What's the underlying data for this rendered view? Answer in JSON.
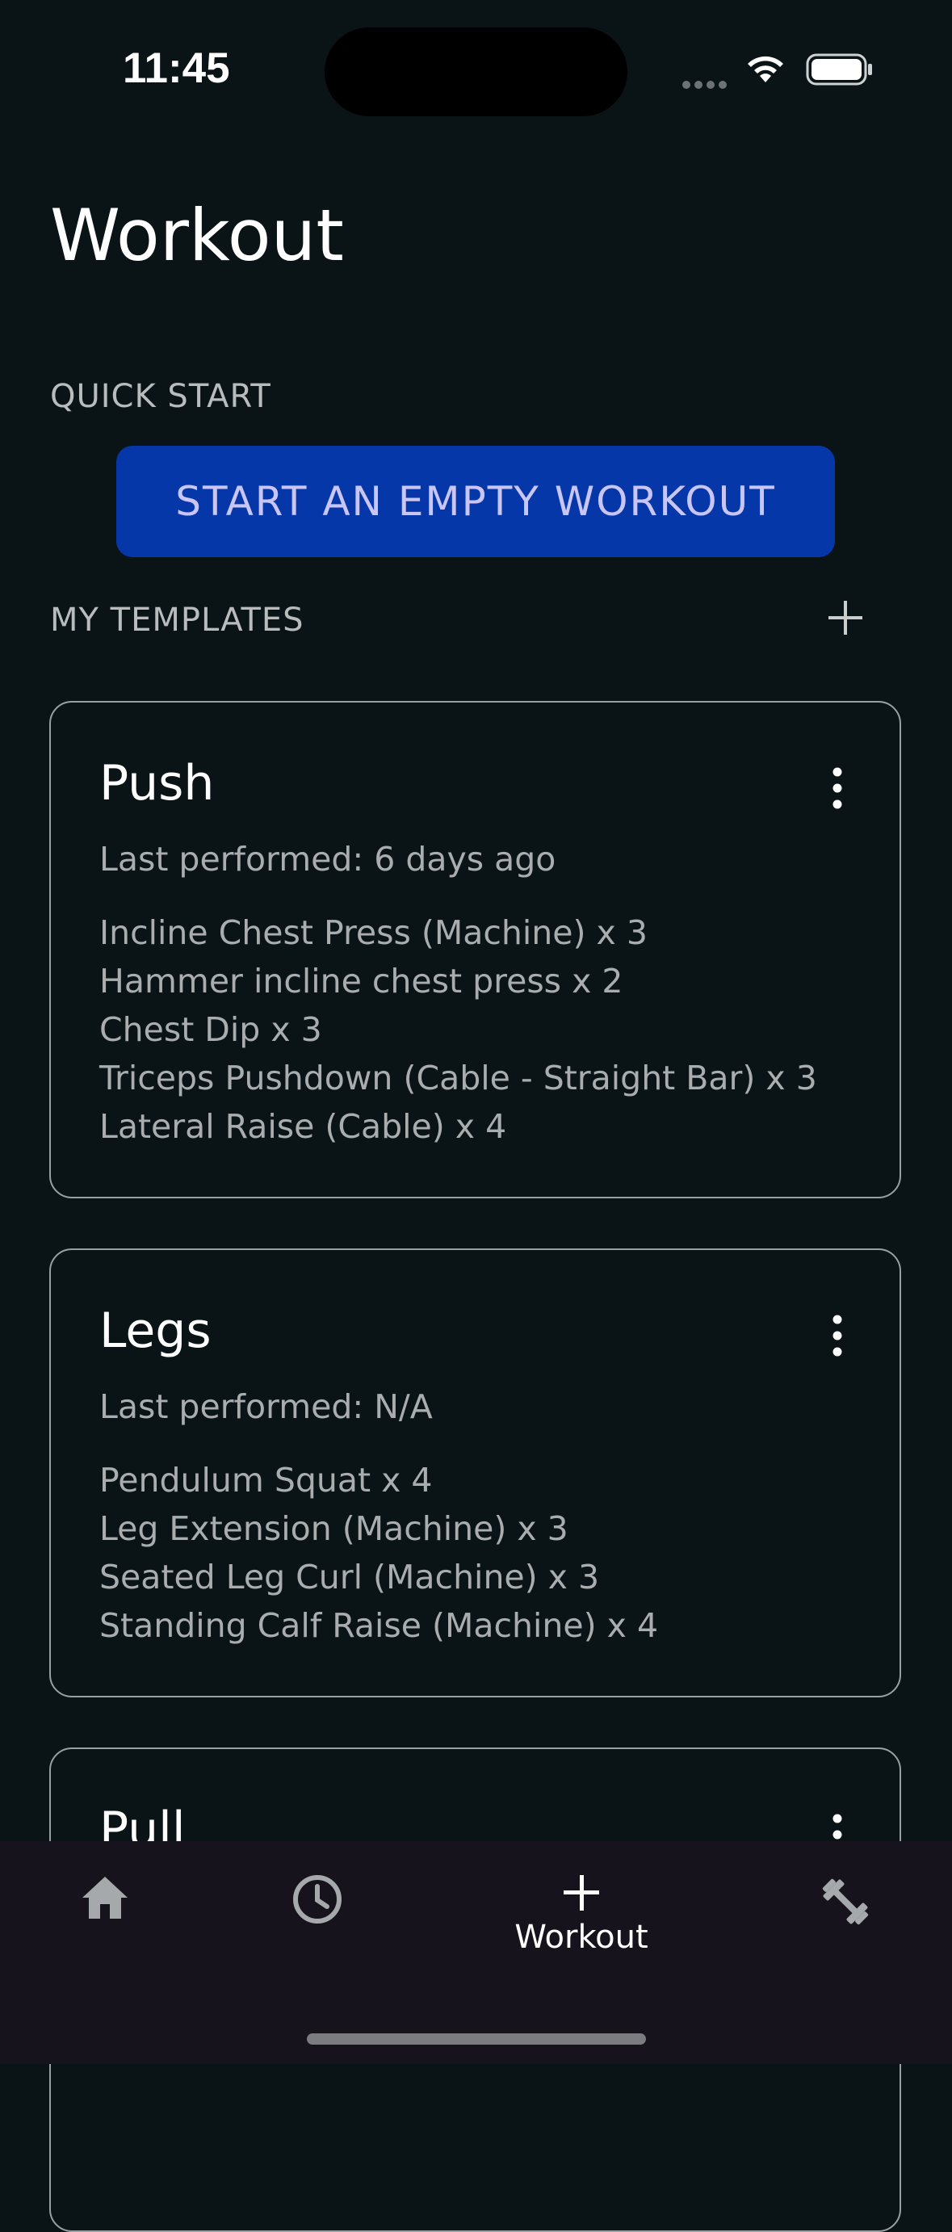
{
  "status_bar": {
    "time": "11:45"
  },
  "header": {
    "title": "Workout"
  },
  "quick_start": {
    "label": "QUICK START",
    "button_label": "START AN EMPTY WORKOUT"
  },
  "templates": {
    "label": "MY TEMPLATES",
    "items": [
      {
        "name": "Push",
        "last_performed": "Last performed: 6 days ago",
        "exercises": [
          "Incline Chest Press (Machine) x 3",
          "Hammer incline chest press x 2",
          "Chest Dip x 3",
          "Triceps Pushdown (Cable - Straight Bar) x 3",
          "Lateral Raise (Cable) x 4"
        ]
      },
      {
        "name": "Legs",
        "last_performed": "Last performed: N/A",
        "exercises": [
          "Pendulum Squat x 4",
          "Leg Extension (Machine) x 3",
          "Seated Leg Curl (Machine) x 3",
          "Standing Calf Raise (Machine) x 4"
        ]
      },
      {
        "name": "Pull"
      }
    ]
  },
  "tab_bar": {
    "items": [
      {
        "icon": "home-icon",
        "label": ""
      },
      {
        "icon": "history-icon",
        "label": ""
      },
      {
        "icon": "plus-icon",
        "label": "Workout"
      },
      {
        "icon": "dumbbell-icon",
        "label": ""
      }
    ]
  },
  "colors": {
    "background": "#0a1417",
    "primary_button": "#0537a8",
    "primary_button_text": "#c9c6f6",
    "card_border": "#9aa0a2",
    "tab_bar": "#17131c"
  }
}
